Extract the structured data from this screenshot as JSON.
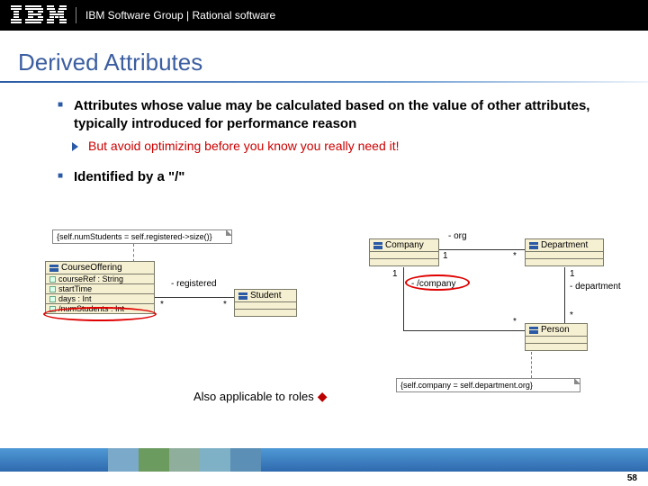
{
  "header": {
    "breadcrumb": "IBM Software Group | Rational software"
  },
  "title": "Derived Attributes",
  "bullets": {
    "b1a": "Attributes whose value may be calculated based on the value of other attributes, typically introduced for performance reason",
    "b2a": "But avoid optimizing before you know you really need it!",
    "b1b": "Identified by a \"/\""
  },
  "diagram": {
    "note_left": "{self.numStudents = self.registered->size()}",
    "class_course": "CourseOffering",
    "attr_courseRef": "courseRef : String",
    "attr_startTime": "startTime",
    "attr_days": "days : Int",
    "attr_numStudents": "/numStudents : Int",
    "role_registered": "- registered",
    "mult_star1": "*",
    "mult_star2": "*",
    "class_student": "Student",
    "class_company": "Company",
    "role_org": "- org",
    "class_department": "Department",
    "mult_1a": "1",
    "mult_stara": "*",
    "mult_1b": "1",
    "mult_starb": "*",
    "role_company": "- /company",
    "role_department": "- department",
    "class_person": "Person",
    "note_right": "{self.company = self.department.org}"
  },
  "caption": "Also applicable to roles",
  "page_number": "58"
}
